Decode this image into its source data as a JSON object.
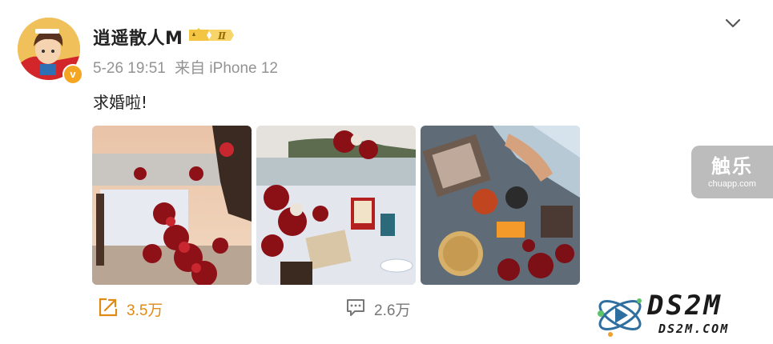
{
  "user": {
    "name": "逍遥散人M",
    "level_badge": "Ⅱ",
    "verified_mark": "v"
  },
  "post": {
    "timestamp": "5-26 19:51",
    "source": "来自 iPhone 12",
    "text": "求婚啦!",
    "images": [
      {
        "alt": "sunset beach proposal table with red roses"
      },
      {
        "alt": "rose-covered table with photos and candles"
      },
      {
        "alt": "dinner table with bread and framed photos at sunset"
      }
    ]
  },
  "actions": {
    "repost_count": "3.5万",
    "comment_count": "2.6万"
  },
  "watermarks": {
    "chuapp_main": "触乐",
    "chuapp_sub": "chuapp.com",
    "ds2m_main": "DS2M",
    "ds2m_sub": "DS2M.COM"
  },
  "colors": {
    "accent_orange": "#e08a16",
    "badge_gold": "#f4c542",
    "meta_gray": "#939393"
  },
  "icons": {
    "more": "chevron-down-icon",
    "repost": "repost-icon",
    "comment": "comment-icon"
  }
}
